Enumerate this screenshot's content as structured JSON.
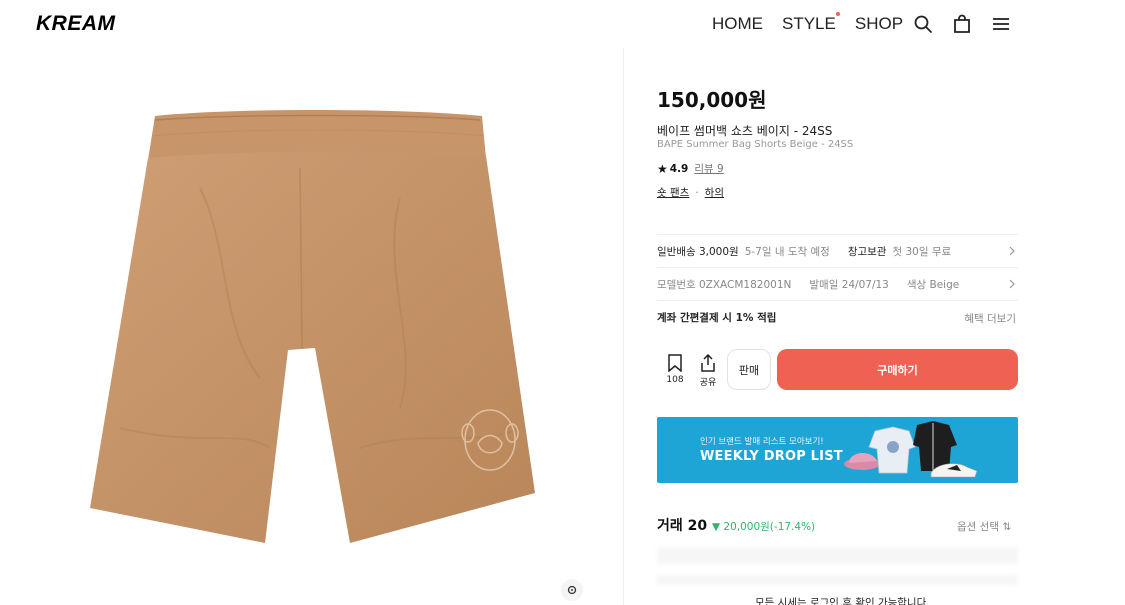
{
  "header": {
    "logo": "KREAM",
    "nav": [
      "HOME",
      "STYLE",
      "SHOP"
    ]
  },
  "product": {
    "price": "150,000원",
    "title_ko": "베이프 썸머백 쇼츠 베이지 - 24SS",
    "title_en": "BAPE Summer Bag Shorts Beige - 24SS",
    "rating": "4.9",
    "review_label": "리뷰 9",
    "tags": [
      "숏 팬츠",
      "하의"
    ],
    "image_description_color": "#c4936a"
  },
  "info_rows": {
    "shipping_label": "일반배송 3,000원",
    "shipping_value": "5-7일 내 도착 예정",
    "storage_label": "창고보관",
    "storage_value": "첫 30일 무료",
    "model_no": "모델번호 0ZXACM182001N",
    "release": "발매일 24/07/13",
    "color": "색상 Beige",
    "promo": "계좌 간편결제 시 1% 적립",
    "promo_more": "혜택 더보기"
  },
  "actions": {
    "wish_count": "108",
    "share_label": "공유",
    "sell_label": "판매",
    "buy_label": "구매하기"
  },
  "banner": {
    "sub": "인기 브랜드 발매 리스트 모아보기!",
    "main": "WEEKLY DROP LIST"
  },
  "trade": {
    "title": "거래 20",
    "delta": "▼ 20,000원(-17.4%)",
    "option": "옵션 선택 ⇅",
    "login_notice": "모든 시세는 로그인 후 확인 가능합니다"
  },
  "colors": {
    "accent": "#ef6253",
    "banner": "#1fa4d6",
    "delta": "#31b46e"
  }
}
